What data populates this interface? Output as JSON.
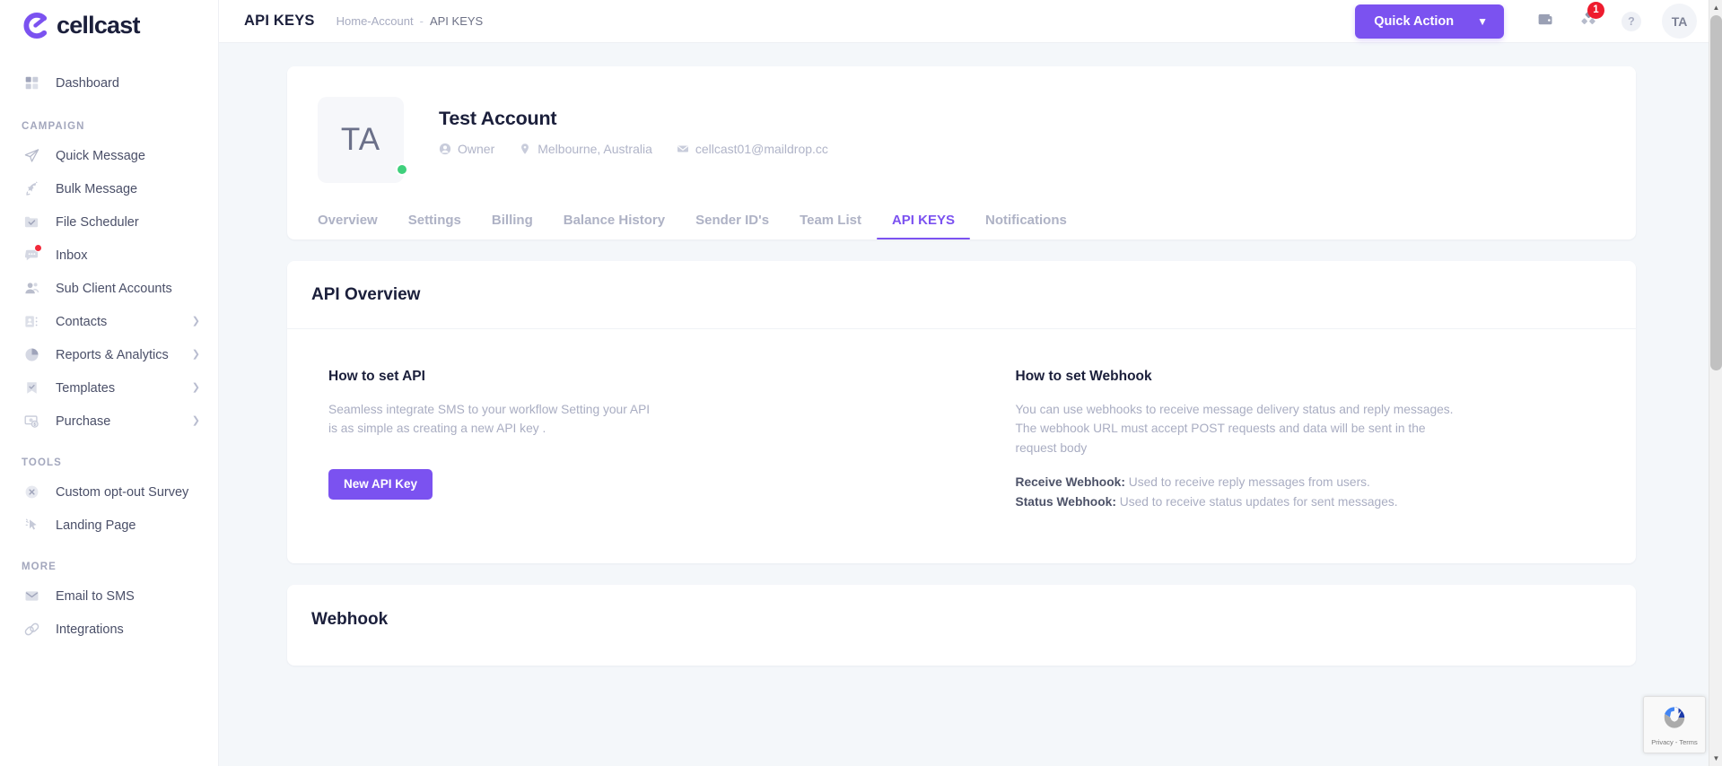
{
  "brand": {
    "name": "cellcast",
    "logo_icon": "cellcast-c-logo",
    "accent": "#7b52f0"
  },
  "sidebar": {
    "collapse_icon": "chevron-double-right-icon",
    "groups": [
      {
        "label": "",
        "items": [
          {
            "label": "Dashboard",
            "icon": "grid-dashboard-icon",
            "chevron": false,
            "badge": false
          }
        ]
      },
      {
        "label": "CAMPAIGN",
        "items": [
          {
            "label": "Quick Message",
            "icon": "paper-plane-icon",
            "chevron": false,
            "badge": false
          },
          {
            "label": "Bulk Message",
            "icon": "rocket-icon",
            "chevron": false,
            "badge": false
          },
          {
            "label": "File Scheduler",
            "icon": "folder-check-icon",
            "chevron": false,
            "badge": false
          },
          {
            "label": "Inbox",
            "icon": "chat-bubble-icon",
            "chevron": false,
            "badge": true
          },
          {
            "label": "Sub Client Accounts",
            "icon": "users-icon",
            "chevron": false,
            "badge": false
          },
          {
            "label": "Contacts",
            "icon": "contact-card-icon",
            "chevron": true,
            "badge": false
          },
          {
            "label": "Reports & Analytics",
            "icon": "pie-chart-icon",
            "chevron": true,
            "badge": false
          },
          {
            "label": "Templates",
            "icon": "bookmark-check-icon",
            "chevron": true,
            "badge": false
          },
          {
            "label": "Purchase",
            "icon": "money-icon",
            "chevron": true,
            "badge": false
          }
        ]
      },
      {
        "label": "TOOLS",
        "items": [
          {
            "label": "Custom opt-out Survey",
            "icon": "circle-x-icon",
            "chevron": false,
            "badge": false
          },
          {
            "label": "Landing Page",
            "icon": "cursor-click-icon",
            "chevron": false,
            "badge": false
          }
        ]
      },
      {
        "label": "MORE",
        "items": [
          {
            "label": "Email to SMS",
            "icon": "envelope-icon",
            "chevron": false,
            "badge": false
          },
          {
            "label": "Integrations",
            "icon": "plug-icon",
            "chevron": false,
            "badge": false
          }
        ]
      }
    ]
  },
  "topbar": {
    "title": "API KEYS",
    "breadcrumb": {
      "home": "Home-Account",
      "separator": "-",
      "current": "API KEYS"
    },
    "quick_action": {
      "label": "Quick Action",
      "chevron": "chevron-down-icon"
    },
    "wallet_icon": "wallet-icon",
    "apps_icon": "apps-diamond-icon",
    "apps_badge": "1",
    "help_icon": "question-mark-icon",
    "help_label": "?",
    "avatar": "TA"
  },
  "account": {
    "avatar_initials": "TA",
    "name": "Test Account",
    "role": "Owner",
    "role_icon": "user-circle-icon",
    "location": "Melbourne, Australia",
    "location_icon": "map-pin-icon",
    "email": "cellcast01@maildrop.cc",
    "email_icon": "envelope-icon",
    "status": "online",
    "tabs": [
      {
        "label": "Overview",
        "active": false
      },
      {
        "label": "Settings",
        "active": false
      },
      {
        "label": "Billing",
        "active": false
      },
      {
        "label": "Balance History",
        "active": false
      },
      {
        "label": "Sender ID's",
        "active": false
      },
      {
        "label": "Team List",
        "active": false
      },
      {
        "label": "API KEYS",
        "active": true
      },
      {
        "label": "Notifications",
        "active": false
      }
    ]
  },
  "api_overview": {
    "title": "API Overview",
    "how_to_set_api": {
      "title": "How to set API",
      "text": "Seamless integrate SMS to your workflow Setting your API is as simple as creating a new API key .",
      "button": "New API Key"
    },
    "how_to_set_webhook": {
      "title": "How to set Webhook",
      "text": "You can use webhooks to receive message delivery status and reply messages. The webhook URL must accept POST requests and data will be sent in the request body",
      "receive_label": "Receive Webhook:",
      "receive_text": " Used to receive reply messages from users.",
      "status_label": "Status Webhook:",
      "status_text": " Used to receive status updates for sent messages."
    }
  },
  "webhook_section": {
    "title": "Webhook"
  },
  "recaptcha": {
    "icon": "recaptcha-icon",
    "text": "Privacy - Terms"
  },
  "scrollbar": {
    "up_icon": "caret-up-icon",
    "down_icon": "caret-down-icon"
  }
}
